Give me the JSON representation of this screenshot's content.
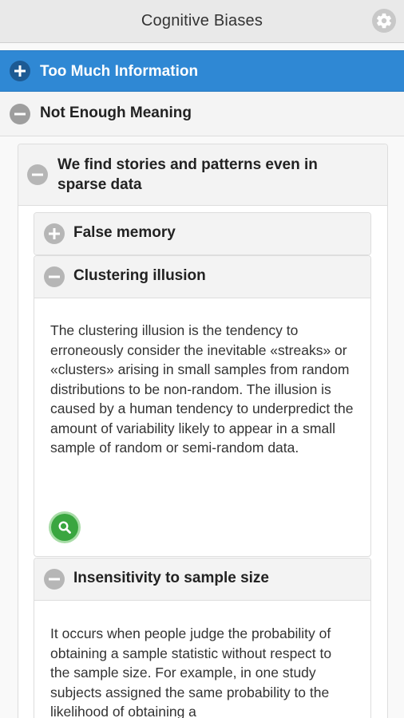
{
  "header": {
    "title": "Cognitive Biases",
    "settings_icon": "gear-icon"
  },
  "sections": [
    {
      "label": "Too Much Information",
      "state": "collapsed",
      "icon": "plus-icon",
      "color": "#2f88d4"
    },
    {
      "label": "Not Enough Meaning",
      "state": "expanded",
      "icon": "minus-icon",
      "subsections": [
        {
          "label": "We find stories and patterns even in sparse data",
          "state": "expanded",
          "icon": "minus-icon",
          "items": [
            {
              "label": "False memory",
              "state": "collapsed",
              "icon": "plus-icon"
            },
            {
              "label": "Clustering illusion",
              "state": "expanded",
              "icon": "minus-icon",
              "description": "The clustering illusion is the tendency to erroneously consider the inevitable «streaks» or «clusters» arising in small samples from random distributions to be non-random. The illusion is caused by a human tendency to underpredict the amount of variability likely to appear in a small sample of random or semi-random data.",
              "action_icon": "search-icon"
            },
            {
              "label": "Insensitivity to sample size",
              "state": "expanded",
              "icon": "minus-icon",
              "description": "It occurs when people judge the probability of obtaining a sample statistic without respect to the sample size. For example, in one study subjects assigned the same probability to the likelihood of obtaining a"
            }
          ]
        }
      ]
    }
  ]
}
